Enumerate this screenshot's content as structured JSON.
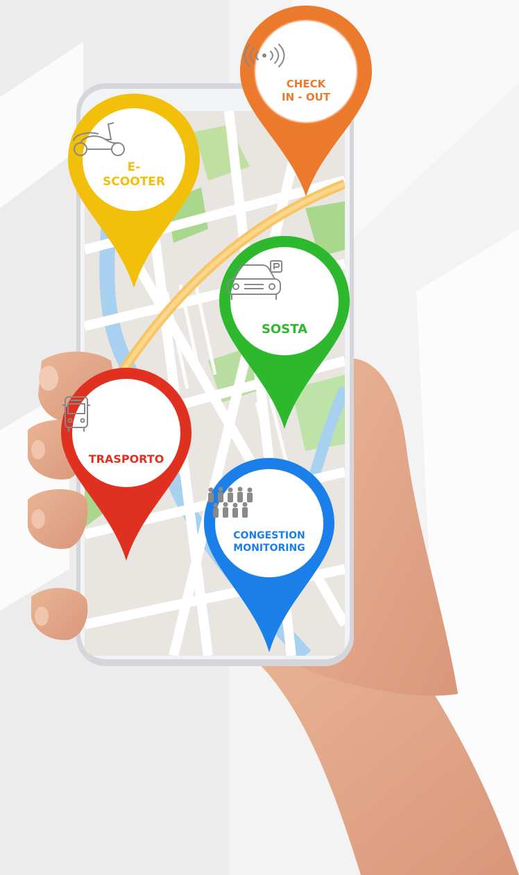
{
  "pins": {
    "checkin": {
      "label": "CHECK\nIN - OUT",
      "color": "#ec7a2d",
      "icon": "nfc-signal-icon"
    },
    "escooter": {
      "label": "E-\nSCOOTER",
      "color": "#f2bf0b",
      "icon": "scooter-icon"
    },
    "sosta": {
      "label": "SOSTA",
      "color": "#2db82d",
      "icon": "parked-car-icon"
    },
    "trasporto": {
      "label": "TRASPORTO",
      "color": "#e03020",
      "icon": "bus-icon"
    },
    "congestion": {
      "label": "CONGESTION\nMONITORING",
      "color": "#1a7fe8",
      "icon": "crowd-icon"
    }
  }
}
